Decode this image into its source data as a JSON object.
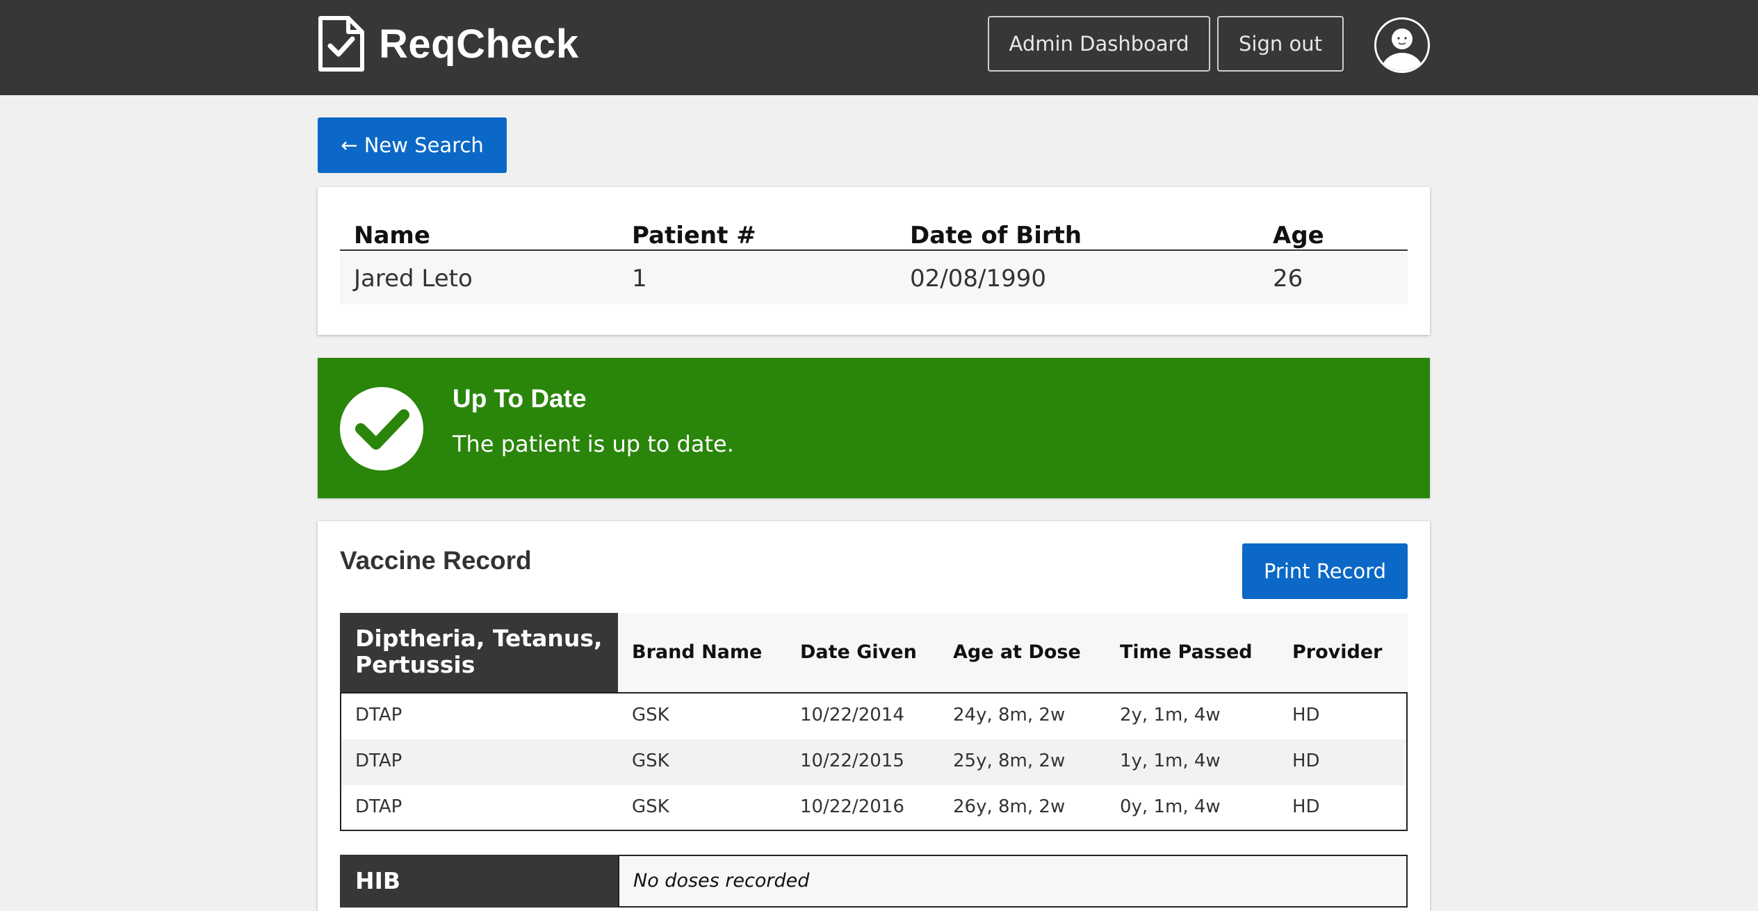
{
  "header": {
    "app_name": "ReqCheck",
    "admin_label": "Admin Dashboard",
    "signout_label": "Sign out",
    "bg_color": "#373737"
  },
  "new_search_label": "← New Search",
  "patient": {
    "columns": [
      "Name",
      "Patient #",
      "Date of Birth",
      "Age"
    ],
    "values": [
      "Jared Leto",
      "1",
      "02/08/1990",
      "26"
    ]
  },
  "status": {
    "title": "Up To Date",
    "message": "The patient is up to date.",
    "color": "#2a850b",
    "icon": "checkmark-icon"
  },
  "vaccine_record": {
    "title": "Vaccine Record",
    "print_label": "Print Record",
    "columns": [
      "Brand Name",
      "Date Given",
      "Age at Dose",
      "Time Passed",
      "Provider"
    ],
    "groups": [
      {
        "name": "Diptheria, Tetanus, Pertussis",
        "rows": [
          [
            "DTAP",
            "GSK",
            "10/22/2014",
            "24y, 8m, 2w",
            "2y, 1m, 4w",
            "HD"
          ],
          [
            "DTAP",
            "GSK",
            "10/22/2015",
            "25y, 8m, 2w",
            "1y, 1m, 4w",
            "HD"
          ],
          [
            "DTAP",
            "GSK",
            "10/22/2016",
            "26y, 8m, 2w",
            "0y, 1m, 4w",
            "HD"
          ]
        ]
      },
      {
        "name": "HIB",
        "empty_message": "No doses recorded"
      }
    ]
  },
  "accent_color": "#0b68c6"
}
